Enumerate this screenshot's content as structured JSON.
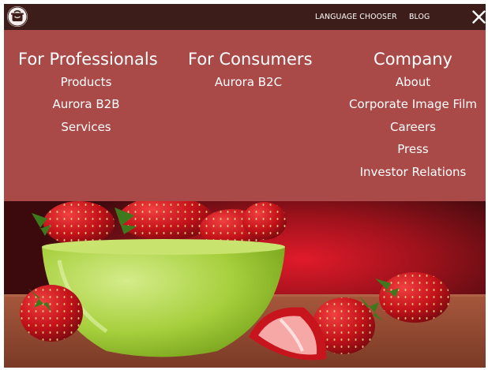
{
  "topbar": {
    "language_label": "LANGUAGE CHOOSER",
    "blog_label": "BLOG",
    "logo_icon": "cooking-pot-icon",
    "close_icon": "close-icon"
  },
  "menu": {
    "columns": [
      {
        "title": "For Professionals",
        "items": [
          "Products",
          "Aurora B2B",
          "Services"
        ]
      },
      {
        "title": "For Consumers",
        "items": [
          "Aurora B2C"
        ]
      },
      {
        "title": "Company",
        "items": [
          "About",
          "Corporate Image Film",
          "Careers",
          "Press",
          "Investor Relations"
        ]
      }
    ]
  },
  "colors": {
    "topbar": "#3d1d19",
    "menu_panel": "#a94a48",
    "text": "#ffffff"
  }
}
